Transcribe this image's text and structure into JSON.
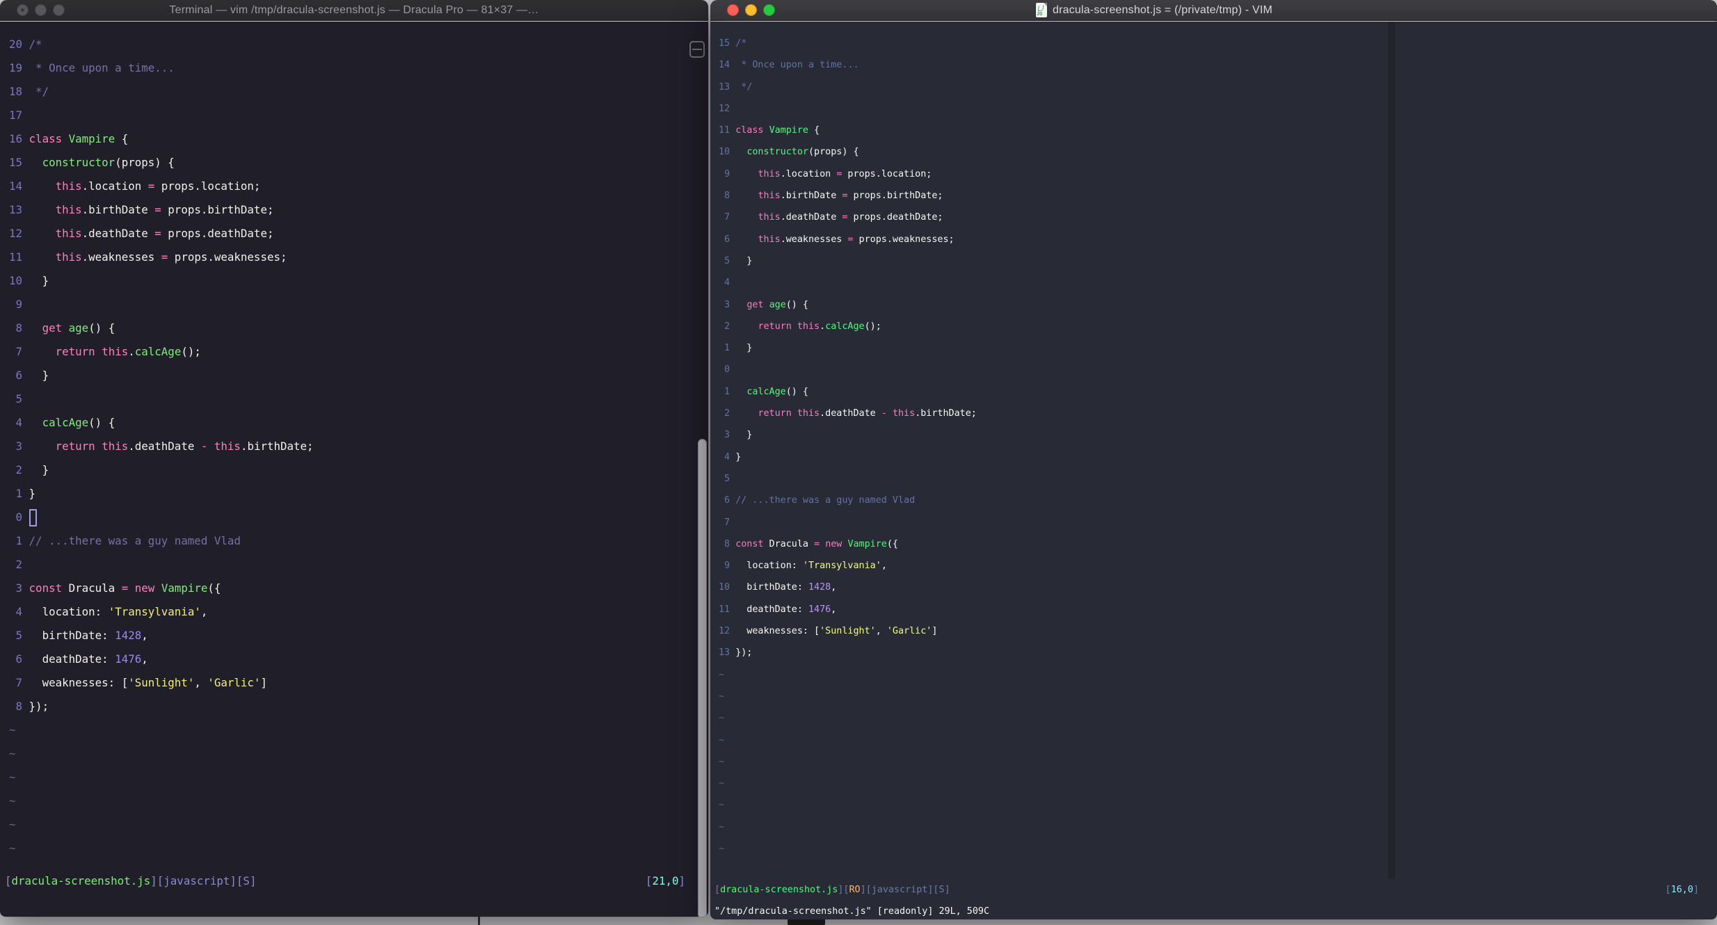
{
  "windows": [
    {
      "title": "Terminal — vim /tmp/dracula-screenshot.js — Dracula Pro — 81×37 —…",
      "theme_name": "Dracula Pro",
      "palette": {
        "bg": "#1f1e29",
        "fg": "#f3f1ea",
        "pink": "#ff80bf",
        "green": "#80ee7a",
        "yellow": "#f1ee7e",
        "num": "#9a89f5",
        "comment": "#7970a9",
        "lnr": "#7d76c0",
        "sb": "#9088d2",
        "cy": "#80ffea",
        "cursor": "#a29de0",
        "orange": "#ffca80"
      },
      "tilde": "~",
      "tildes": 6,
      "cmdline": "",
      "status_left": [
        [
          "sb",
          "["
        ],
        [
          "g",
          "dracula-screenshot.js"
        ],
        [
          "sb",
          "]["
        ],
        [
          "sb",
          "javascript"
        ],
        [
          "sb",
          "]["
        ],
        [
          "sb",
          "S"
        ],
        [
          "sb",
          "]"
        ]
      ],
      "status_right": [
        [
          "sb",
          "["
        ],
        [
          "cy",
          "21,0"
        ],
        [
          "sb",
          "]"
        ]
      ],
      "lines": [
        {
          "n": "20",
          "t": [
            [
              "c",
              "/*"
            ]
          ]
        },
        {
          "n": "19",
          "t": [
            [
              "c",
              " * Once upon a time..."
            ]
          ]
        },
        {
          "n": "18",
          "t": [
            [
              "c",
              " */"
            ]
          ]
        },
        {
          "n": "17",
          "t": []
        },
        {
          "n": "16",
          "t": [
            [
              "p",
              "class"
            ],
            [
              "f",
              " "
            ],
            [
              "g",
              "Vampire"
            ],
            [
              "f",
              " {"
            ]
          ]
        },
        {
          "n": "15",
          "t": [
            [
              "f",
              "  "
            ],
            [
              "g",
              "constructor"
            ],
            [
              "f",
              "(props) {"
            ]
          ]
        },
        {
          "n": "14",
          "t": [
            [
              "f",
              "    "
            ],
            [
              "p",
              "this"
            ],
            [
              "f",
              ".location "
            ],
            [
              "p",
              "="
            ],
            [
              "f",
              " props.location;"
            ]
          ]
        },
        {
          "n": "13",
          "t": [
            [
              "f",
              "    "
            ],
            [
              "p",
              "this"
            ],
            [
              "f",
              ".birthDate "
            ],
            [
              "p",
              "="
            ],
            [
              "f",
              " props.birthDate;"
            ]
          ]
        },
        {
          "n": "12",
          "t": [
            [
              "f",
              "    "
            ],
            [
              "p",
              "this"
            ],
            [
              "f",
              ".deathDate "
            ],
            [
              "p",
              "="
            ],
            [
              "f",
              " props.deathDate;"
            ]
          ]
        },
        {
          "n": "11",
          "t": [
            [
              "f",
              "    "
            ],
            [
              "p",
              "this"
            ],
            [
              "f",
              ".weaknesses "
            ],
            [
              "p",
              "="
            ],
            [
              "f",
              " props.weaknesses;"
            ]
          ]
        },
        {
          "n": "10",
          "t": [
            [
              "f",
              "  }"
            ]
          ]
        },
        {
          "n": "9",
          "t": []
        },
        {
          "n": "8",
          "t": [
            [
              "f",
              "  "
            ],
            [
              "p",
              "get"
            ],
            [
              "f",
              " "
            ],
            [
              "g",
              "age"
            ],
            [
              "f",
              "() {"
            ]
          ]
        },
        {
          "n": "7",
          "t": [
            [
              "f",
              "    "
            ],
            [
              "p",
              "return"
            ],
            [
              "f",
              " "
            ],
            [
              "p",
              "this"
            ],
            [
              "f",
              "."
            ],
            [
              "g",
              "calcAge"
            ],
            [
              "f",
              "();"
            ]
          ]
        },
        {
          "n": "6",
          "t": [
            [
              "f",
              "  }"
            ]
          ]
        },
        {
          "n": "5",
          "t": []
        },
        {
          "n": "4",
          "t": [
            [
              "f",
              "  "
            ],
            [
              "g",
              "calcAge"
            ],
            [
              "f",
              "() {"
            ]
          ]
        },
        {
          "n": "3",
          "t": [
            [
              "f",
              "    "
            ],
            [
              "p",
              "return"
            ],
            [
              "f",
              " "
            ],
            [
              "p",
              "this"
            ],
            [
              "f",
              ".deathDate "
            ],
            [
              "p",
              "-"
            ],
            [
              "f",
              " "
            ],
            [
              "p",
              "this"
            ],
            [
              "f",
              ".birthDate;"
            ]
          ]
        },
        {
          "n": "2",
          "t": [
            [
              "f",
              "  }"
            ]
          ]
        },
        {
          "n": "1",
          "t": [
            [
              "f",
              "}"
            ]
          ]
        },
        {
          "n": "0",
          "t": [
            [
              "cur",
              " "
            ]
          ]
        },
        {
          "n": "1",
          "t": [
            [
              "c",
              "// ...there was a guy named Vlad"
            ]
          ]
        },
        {
          "n": "2",
          "t": []
        },
        {
          "n": "3",
          "t": [
            [
              "p",
              "const"
            ],
            [
              "f",
              " Dracula "
            ],
            [
              "p",
              "="
            ],
            [
              "f",
              " "
            ],
            [
              "p",
              "new"
            ],
            [
              "f",
              " "
            ],
            [
              "g",
              "Vampire"
            ],
            [
              "f",
              "({"
            ]
          ]
        },
        {
          "n": "4",
          "t": [
            [
              "f",
              "  location: "
            ],
            [
              "y",
              "'Transylvania'"
            ],
            [
              "f",
              ","
            ]
          ]
        },
        {
          "n": "5",
          "t": [
            [
              "f",
              "  birthDate: "
            ],
            [
              "num",
              "1428"
            ],
            [
              "f",
              ","
            ]
          ]
        },
        {
          "n": "6",
          "t": [
            [
              "f",
              "  deathDate: "
            ],
            [
              "num",
              "1476"
            ],
            [
              "f",
              ","
            ]
          ]
        },
        {
          "n": "7",
          "t": [
            [
              "f",
              "  weaknesses: ["
            ],
            [
              "y",
              "'Sunlight'"
            ],
            [
              "f",
              ", "
            ],
            [
              "y",
              "'Garlic'"
            ],
            [
              "f",
              "]"
            ]
          ]
        },
        {
          "n": "8",
          "t": [
            [
              "f",
              "});"
            ]
          ]
        }
      ]
    },
    {
      "title": "dracula-screenshot.js = (/private/tmp) - VIM",
      "theme_name": "Dracula",
      "palette": {
        "bg": "#282a36",
        "fg": "#f8f8f2",
        "pink": "#ff79c6",
        "green": "#50fa7b",
        "yellow": "#f1fa8c",
        "num": "#bd93f9",
        "comment": "#6272a4",
        "lnr": "#6272a4",
        "sb": "#6d7ba6",
        "cy": "#8be9fd",
        "cursor": "#f8f8f2",
        "orange": "#ffb86c"
      },
      "tilde": "~",
      "tildes": 9,
      "cmdline": "\"/tmp/dracula-screenshot.js\" [readonly] 29L, 509C",
      "status_left": [
        [
          "sb",
          "["
        ],
        [
          "g",
          "dracula-screenshot.js"
        ],
        [
          "sb",
          "]["
        ],
        [
          "o",
          "RO"
        ],
        [
          "sb",
          "]["
        ],
        [
          "sb",
          "javascript"
        ],
        [
          "sb",
          "]["
        ],
        [
          "sb",
          "S"
        ],
        [
          "sb",
          "]"
        ]
      ],
      "status_right": [
        [
          "sb",
          "["
        ],
        [
          "cy",
          "16,0"
        ],
        [
          "sb",
          "]"
        ]
      ],
      "lines": [
        {
          "n": "15",
          "t": [
            [
              "c",
              "/*"
            ]
          ]
        },
        {
          "n": "14",
          "t": [
            [
              "c",
              " * Once upon a time..."
            ]
          ]
        },
        {
          "n": "13",
          "t": [
            [
              "c",
              " */"
            ]
          ]
        },
        {
          "n": "12",
          "t": []
        },
        {
          "n": "11",
          "t": [
            [
              "p",
              "class"
            ],
            [
              "f",
              " "
            ],
            [
              "g",
              "Vampire"
            ],
            [
              "f",
              " {"
            ]
          ]
        },
        {
          "n": "10",
          "t": [
            [
              "f",
              "  "
            ],
            [
              "g",
              "constructor"
            ],
            [
              "f",
              "(props) {"
            ]
          ]
        },
        {
          "n": "9",
          "t": [
            [
              "f",
              "    "
            ],
            [
              "p",
              "this"
            ],
            [
              "f",
              ".location "
            ],
            [
              "p",
              "="
            ],
            [
              "f",
              " props.location;"
            ]
          ]
        },
        {
          "n": "8",
          "t": [
            [
              "f",
              "    "
            ],
            [
              "p",
              "this"
            ],
            [
              "f",
              ".birthDate "
            ],
            [
              "p",
              "="
            ],
            [
              "f",
              " props.birthDate;"
            ]
          ]
        },
        {
          "n": "7",
          "t": [
            [
              "f",
              "    "
            ],
            [
              "p",
              "this"
            ],
            [
              "f",
              ".deathDate "
            ],
            [
              "p",
              "="
            ],
            [
              "f",
              " props.deathDate;"
            ]
          ]
        },
        {
          "n": "6",
          "t": [
            [
              "f",
              "    "
            ],
            [
              "p",
              "this"
            ],
            [
              "f",
              ".weaknesses "
            ],
            [
              "p",
              "="
            ],
            [
              "f",
              " props.weaknesses;"
            ]
          ]
        },
        {
          "n": "5",
          "t": [
            [
              "f",
              "  }"
            ]
          ]
        },
        {
          "n": "4",
          "t": []
        },
        {
          "n": "3",
          "t": [
            [
              "f",
              "  "
            ],
            [
              "p",
              "get"
            ],
            [
              "f",
              " "
            ],
            [
              "g",
              "age"
            ],
            [
              "f",
              "() {"
            ]
          ]
        },
        {
          "n": "2",
          "t": [
            [
              "f",
              "    "
            ],
            [
              "p",
              "return"
            ],
            [
              "f",
              " "
            ],
            [
              "p",
              "this"
            ],
            [
              "f",
              "."
            ],
            [
              "g",
              "calcAge"
            ],
            [
              "f",
              "();"
            ]
          ]
        },
        {
          "n": "1",
          "t": [
            [
              "f",
              "  }"
            ]
          ]
        },
        {
          "n": "0",
          "t": []
        },
        {
          "n": "1",
          "t": [
            [
              "f",
              "  "
            ],
            [
              "g",
              "calcAge"
            ],
            [
              "f",
              "() {"
            ]
          ]
        },
        {
          "n": "2",
          "t": [
            [
              "f",
              "    "
            ],
            [
              "p",
              "return"
            ],
            [
              "f",
              " "
            ],
            [
              "p",
              "this"
            ],
            [
              "f",
              ".deathDate "
            ],
            [
              "p",
              "-"
            ],
            [
              "f",
              " "
            ],
            [
              "p",
              "this"
            ],
            [
              "f",
              ".birthDate;"
            ]
          ]
        },
        {
          "n": "3",
          "t": [
            [
              "f",
              "  }"
            ]
          ]
        },
        {
          "n": "4",
          "t": [
            [
              "f",
              "}"
            ]
          ]
        },
        {
          "n": "5",
          "t": []
        },
        {
          "n": "6",
          "t": [
            [
              "c",
              "// ...there was a guy named Vlad"
            ]
          ]
        },
        {
          "n": "7",
          "t": []
        },
        {
          "n": "8",
          "t": [
            [
              "p",
              "const"
            ],
            [
              "f",
              " Dracula "
            ],
            [
              "p",
              "="
            ],
            [
              "f",
              " "
            ],
            [
              "p",
              "new"
            ],
            [
              "f",
              " "
            ],
            [
              "g",
              "Vampire"
            ],
            [
              "f",
              "({"
            ]
          ]
        },
        {
          "n": "9",
          "t": [
            [
              "f",
              "  location: "
            ],
            [
              "y",
              "'Transylvania'"
            ],
            [
              "f",
              ","
            ]
          ]
        },
        {
          "n": "10",
          "t": [
            [
              "f",
              "  birthDate: "
            ],
            [
              "num",
              "1428"
            ],
            [
              "f",
              ","
            ]
          ]
        },
        {
          "n": "11",
          "t": [
            [
              "f",
              "  deathDate: "
            ],
            [
              "num",
              "1476"
            ],
            [
              "f",
              ","
            ]
          ]
        },
        {
          "n": "12",
          "t": [
            [
              "f",
              "  weaknesses: ["
            ],
            [
              "y",
              "'Sunlight'"
            ],
            [
              "f",
              ", "
            ],
            [
              "y",
              "'Garlic'"
            ],
            [
              "f",
              "]"
            ]
          ]
        },
        {
          "n": "13",
          "t": [
            [
              "f",
              "});"
            ]
          ]
        }
      ]
    }
  ]
}
